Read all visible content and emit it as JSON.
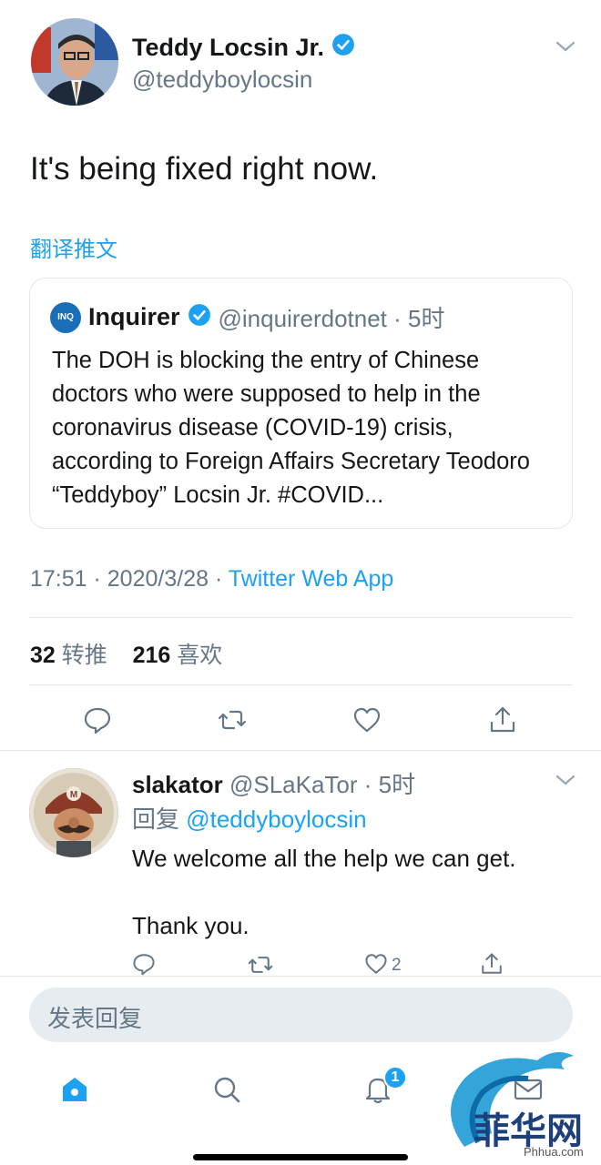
{
  "tweet": {
    "author_name": "Teddy Locsin Jr.",
    "author_handle": "@teddyboylocsin",
    "text": "It's being fixed right now.",
    "translate_label": "翻译推文",
    "timestamp": "17:51 · 2020/3/28 · ",
    "source": "Twitter Web App",
    "retweets_count": "32",
    "retweets_label": " 转推",
    "likes_count": "216",
    "likes_label": " 喜欢"
  },
  "quoted": {
    "logo_text": "INQ",
    "name": "Inquirer",
    "handle_time": "@inquirerdotnet · 5时",
    "text": "The DOH is blocking the entry of Chinese doctors who were supposed to help in the coronavirus disease (COVID-19) crisis, according to Foreign Affairs Secretary Teodoro “Teddyboy” Locsin Jr. #COVID..."
  },
  "actions": [
    "reply-icon",
    "retweet-icon",
    "like-icon",
    "share-icon"
  ],
  "reply": {
    "name": "slakator",
    "handle_time": " @SLaKaTor · 5时",
    "replying_label": "回复 ",
    "replying_to": "@teddyboylocsin",
    "text": "We welcome all the help we can get.\n\nThank you.",
    "like_count": "2"
  },
  "composer": {
    "placeholder": "发表回复"
  },
  "tabbar": {
    "items": [
      "home-icon",
      "search-icon",
      "notifications-icon",
      "messages-icon"
    ],
    "notification_badge": "1"
  },
  "watermark": {
    "text": "菲华网",
    "sub": "Phhua.com"
  },
  "colors": {
    "accent": "#1da1f2",
    "text": "#14171a",
    "secondary": "#657786",
    "divider": "#e1e8ed"
  }
}
